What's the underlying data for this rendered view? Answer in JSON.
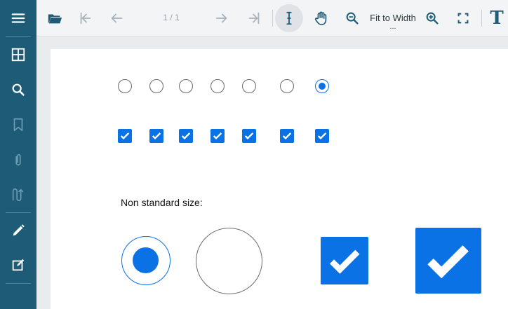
{
  "sidebar": {
    "items": [
      {
        "name": "menu-icon"
      },
      {
        "name": "thumbnails-icon"
      },
      {
        "name": "search-icon"
      },
      {
        "name": "bookmark-icon"
      },
      {
        "name": "attachment-icon"
      },
      {
        "name": "signature-icon"
      },
      {
        "name": "pencil-icon"
      },
      {
        "name": "edit-form-icon"
      }
    ],
    "background": "#1e5b76"
  },
  "toolbar": {
    "page_counter": "1 / 1",
    "zoom_label": "Fit to Width",
    "zoom_dots": "...",
    "text_tool_glyph": "T"
  },
  "document": {
    "non_standard_label": "Non standard size:",
    "small_radios": [
      {
        "checked": false
      },
      {
        "checked": false
      },
      {
        "checked": false
      },
      {
        "checked": false
      },
      {
        "checked": false
      },
      {
        "checked": false
      },
      {
        "checked": true
      }
    ],
    "small_checkboxes": [
      {
        "checked": true
      },
      {
        "checked": true
      },
      {
        "checked": true
      },
      {
        "checked": true
      },
      {
        "checked": true
      },
      {
        "checked": true
      },
      {
        "checked": true
      }
    ],
    "large_controls": [
      {
        "type": "radio",
        "checked": true
      },
      {
        "type": "radio",
        "checked": false
      },
      {
        "type": "checkbox",
        "checked": true
      },
      {
        "type": "checkbox",
        "checked": true
      }
    ],
    "accent_color": "#0b72e6"
  }
}
